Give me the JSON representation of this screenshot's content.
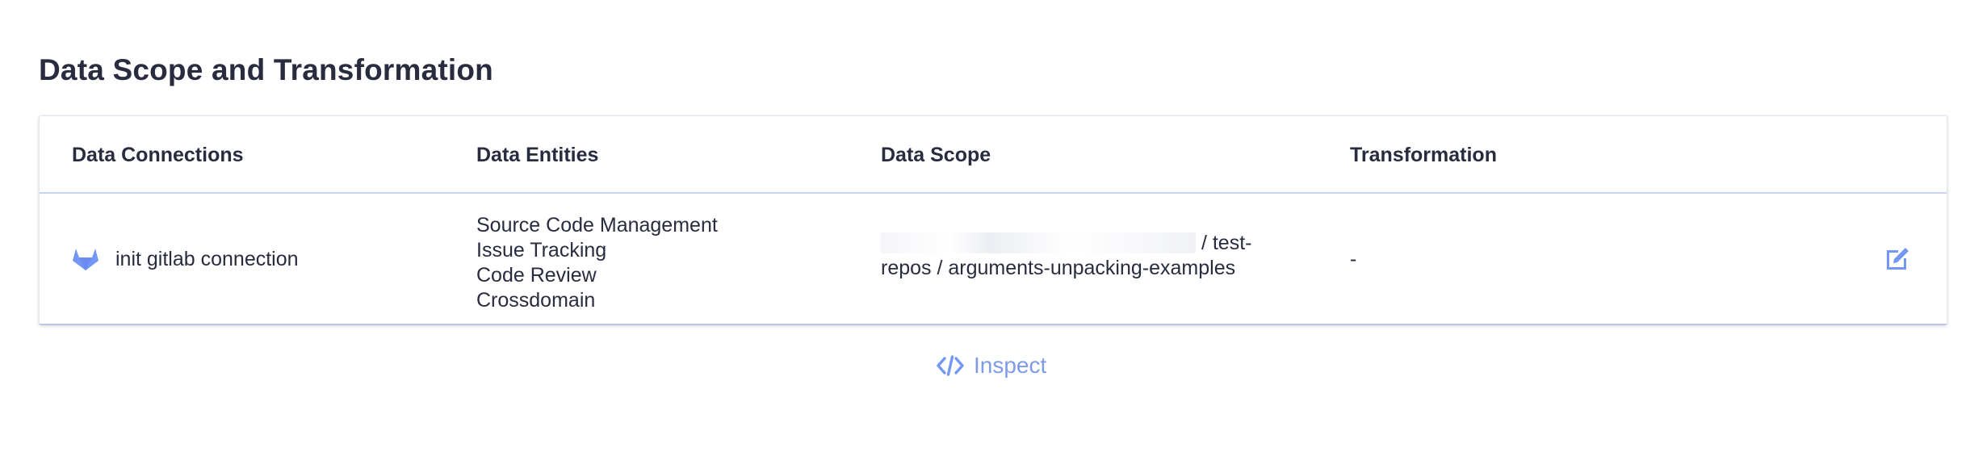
{
  "section": {
    "title": "Data Scope and Transformation"
  },
  "table": {
    "headers": [
      "Data Connections",
      "Data Entities",
      "Data Scope",
      "Transformation"
    ],
    "row": {
      "connection_icon": "gitlab-icon",
      "connection_name": "init gitlab connection",
      "entities": [
        "Source Code Management",
        "Issue Tracking",
        "Code Review",
        "Crossdomain"
      ],
      "scope_visible_text": "/ test-",
      "scope_line2": "repos / arguments-unpacking-examples",
      "transformation": "-",
      "edit_icon": "edit-icon"
    }
  },
  "footer": {
    "inspect_label": "Inspect",
    "inspect_icon": "code-icon"
  },
  "colors": {
    "accent": "#7497F7",
    "text": "#292B3F",
    "divider": "#C8D2EE"
  }
}
